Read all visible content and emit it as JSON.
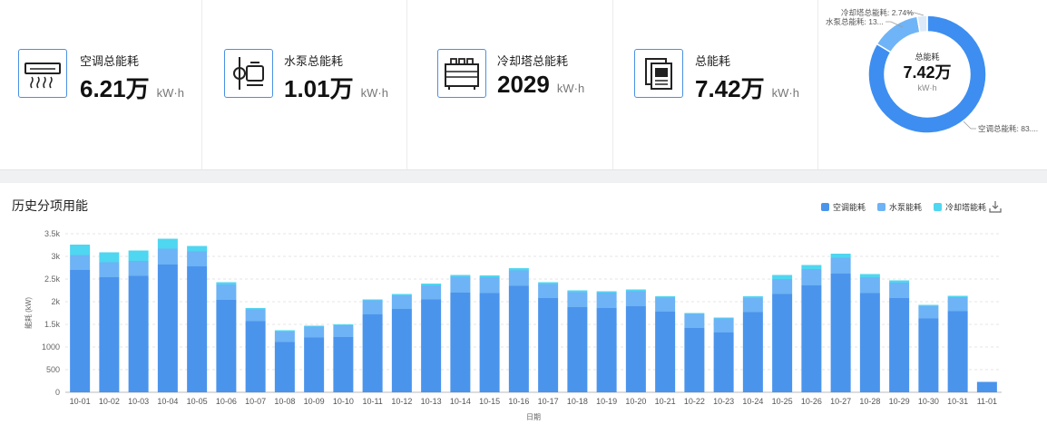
{
  "summary": {
    "cards": [
      {
        "label": "空调总能耗",
        "value": "6.21万",
        "unit": "kW·h",
        "icon": "air-conditioner-icon"
      },
      {
        "label": "水泵总能耗",
        "value": "1.01万",
        "unit": "kW·h",
        "icon": "water-pump-icon"
      },
      {
        "label": "冷却塔总能耗",
        "value": "2029",
        "unit": "kW·h",
        "icon": "cooling-tower-icon"
      },
      {
        "label": "总能耗",
        "value": "7.42万",
        "unit": "kW·h",
        "icon": "document-icon"
      }
    ]
  },
  "donut": {
    "center_label": "总能耗",
    "center_value": "7.42万",
    "center_unit": "kW·h",
    "callouts": [
      {
        "text": "冷却塔总能耗: 2.74%"
      },
      {
        "text": "水泵总能耗: 13..."
      },
      {
        "text": "空调总能耗: 83...."
      }
    ],
    "colors": {
      "ac": "#3d8ef0",
      "pump": "#6fb4f7",
      "tower": "#dbe9f8"
    }
  },
  "section": {
    "title": "历史分项用能"
  },
  "download_icon": "download-icon",
  "chart_data": {
    "type": "bar",
    "stacked": true,
    "categories": [
      "10-01",
      "10-02",
      "10-03",
      "10-04",
      "10-05",
      "10-06",
      "10-07",
      "10-08",
      "10-09",
      "10-10",
      "10-11",
      "10-12",
      "10-13",
      "10-14",
      "10-15",
      "10-16",
      "10-17",
      "10-18",
      "10-19",
      "10-20",
      "10-21",
      "10-22",
      "10-23",
      "10-24",
      "10-25",
      "10-26",
      "10-27",
      "10-28",
      "10-29",
      "10-30",
      "10-31",
      "11-01"
    ],
    "series": [
      {
        "name": "空调能耗",
        "color": "#4a94ec",
        "values": [
          2700,
          2540,
          2570,
          2820,
          2780,
          2040,
          1570,
          1110,
          1210,
          1220,
          1720,
          1840,
          2050,
          2200,
          2190,
          2350,
          2080,
          1880,
          1860,
          1900,
          1780,
          1420,
          1320,
          1770,
          2170,
          2360,
          2620,
          2190,
          2080,
          1630,
          1790,
          230
        ]
      },
      {
        "name": "水泵能耗",
        "color": "#6db3f5",
        "values": [
          330,
          330,
          330,
          350,
          330,
          340,
          260,
          230,
          240,
          260,
          310,
          300,
          310,
          350,
          350,
          340,
          310,
          330,
          340,
          330,
          310,
          310,
          310,
          310,
          330,
          360,
          350,
          350,
          340,
          270,
          310,
          0
        ]
      },
      {
        "name": "冷却塔能耗",
        "color": "#4fd6f0",
        "values": [
          230,
          220,
          230,
          220,
          120,
          50,
          30,
          30,
          20,
          20,
          20,
          30,
          40,
          40,
          40,
          50,
          40,
          40,
          30,
          40,
          30,
          20,
          20,
          40,
          90,
          90,
          90,
          70,
          50,
          30,
          30,
          0
        ]
      }
    ],
    "xlabel": "日期",
    "ylabel": "能耗 (kW)",
    "ylim": [
      0,
      3500
    ],
    "yticks": [
      "0",
      "500",
      "1000",
      "1.5k",
      "2k",
      "2.5k",
      "3k",
      "3.5k"
    ],
    "grid": true,
    "legend_position": "top-right"
  }
}
